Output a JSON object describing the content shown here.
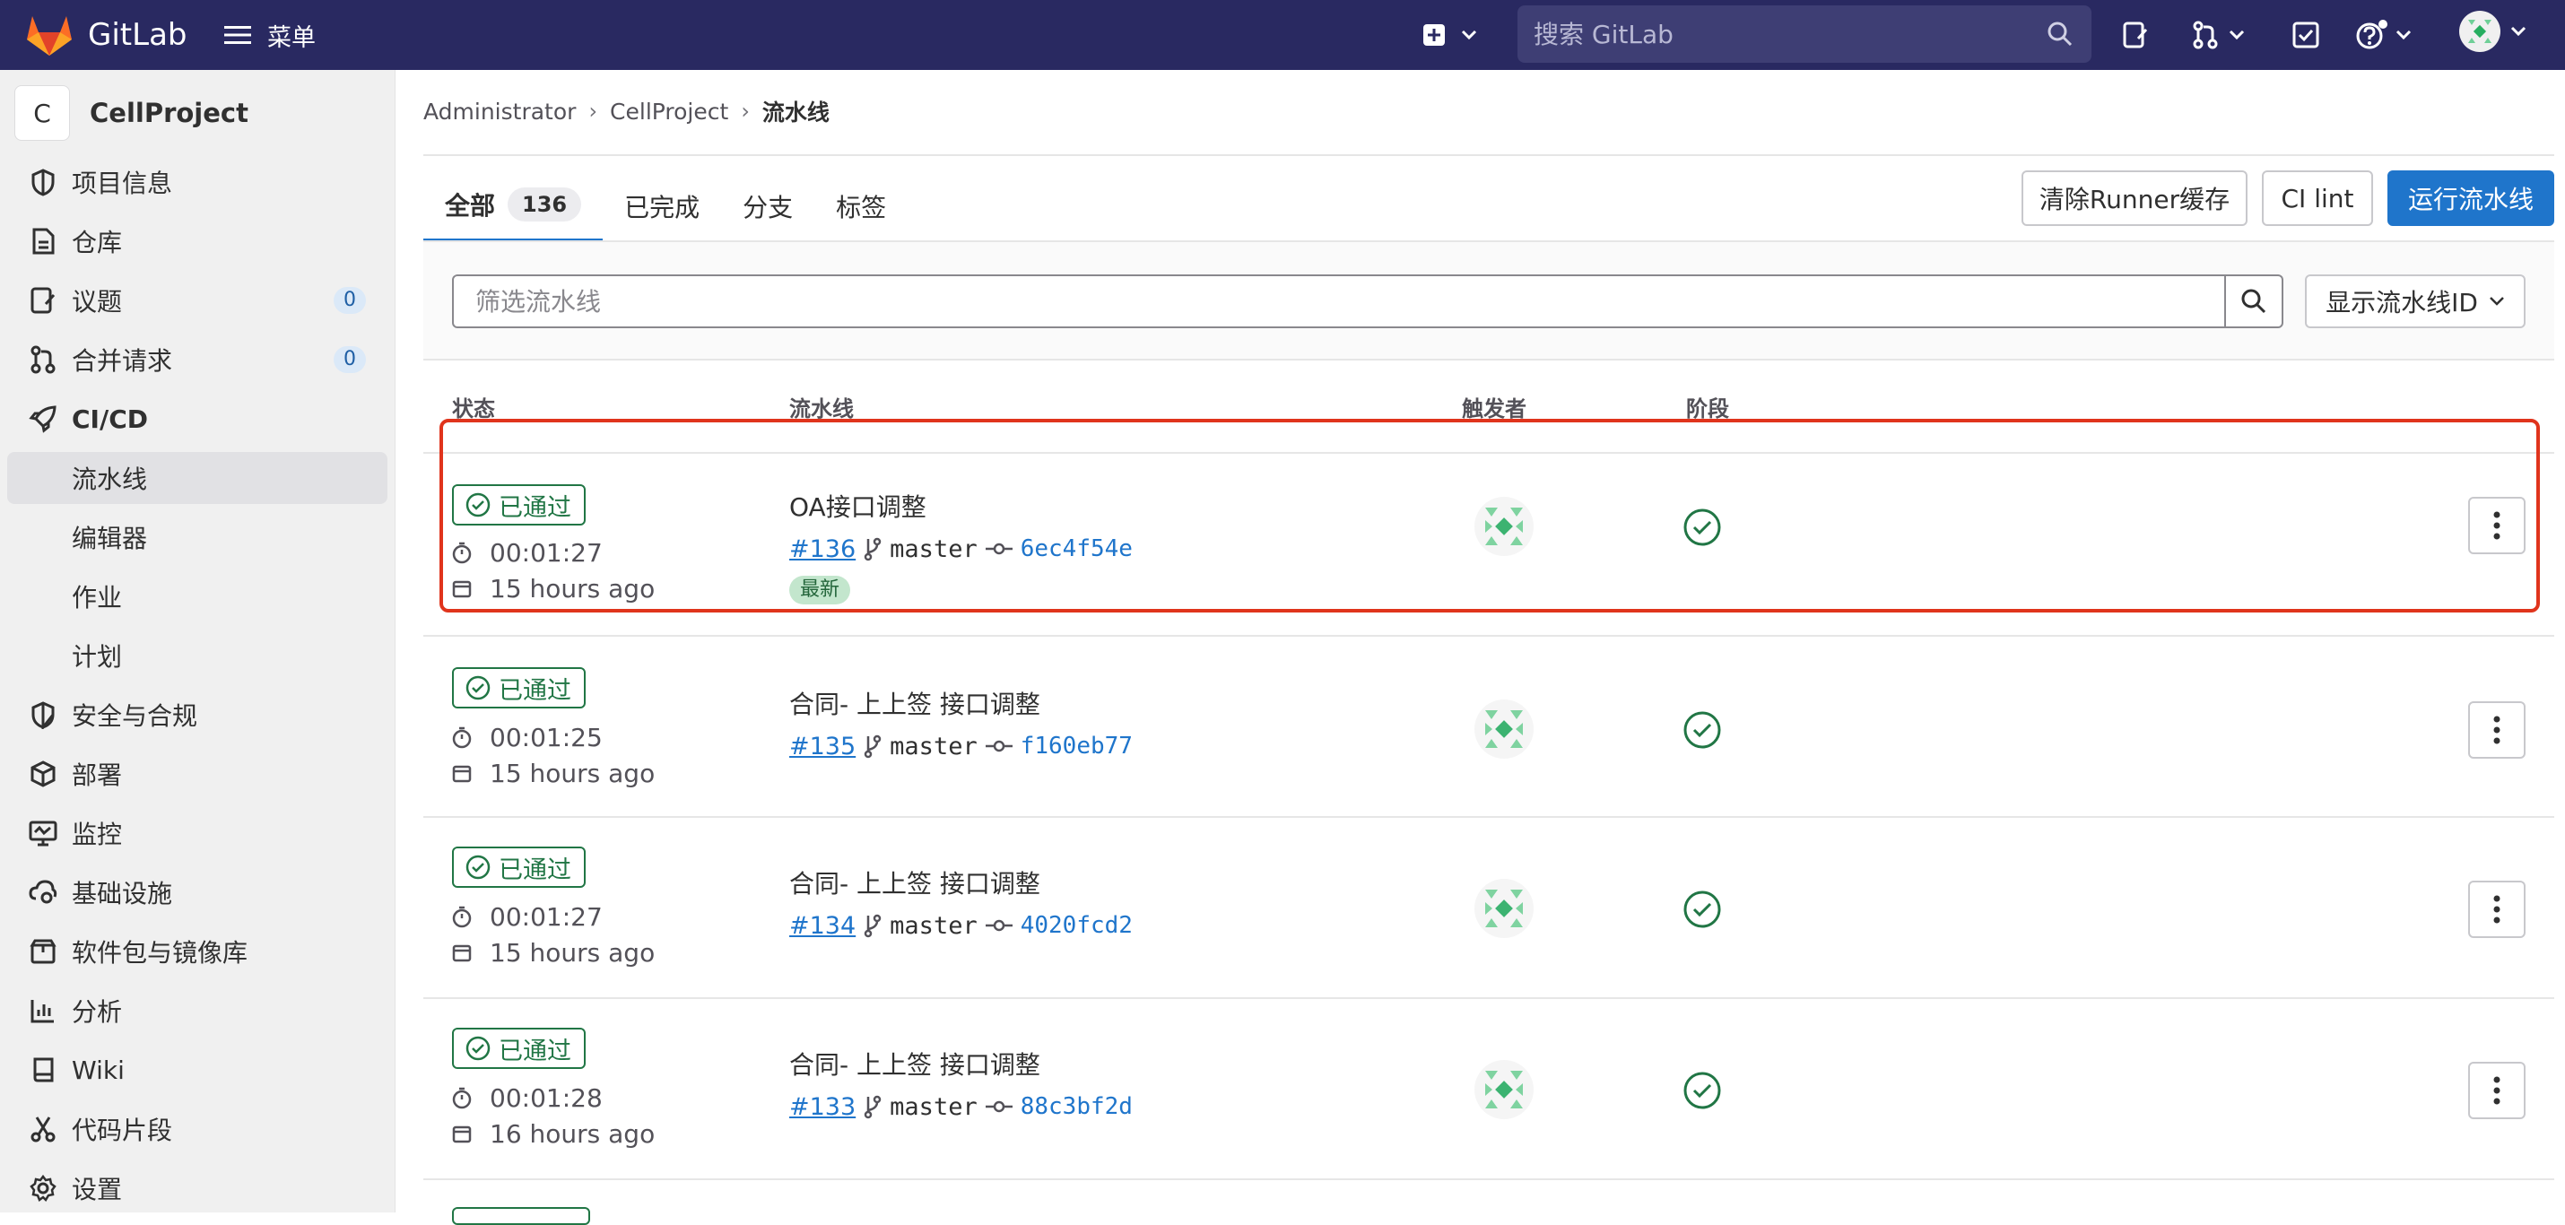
{
  "topbar": {
    "brand": "GitLab",
    "menu_label": "菜单",
    "search_placeholder": "搜索 GitLab",
    "icons": [
      "plus-square-icon",
      "chevron-down-icon",
      "search-icon",
      "issues-icon",
      "merge-request-icon",
      "todo-icon",
      "help-icon",
      "avatar"
    ]
  },
  "sidebar": {
    "project_initial": "C",
    "project_name": "CellProject",
    "items": [
      {
        "label": "项目信息",
        "icon": "info-icon"
      },
      {
        "label": "仓库",
        "icon": "doc-icon"
      },
      {
        "label": "议题",
        "icon": "issues-icon",
        "count": "0"
      },
      {
        "label": "合并请求",
        "icon": "merge-request-icon",
        "count": "0"
      },
      {
        "label": "CI/CD",
        "icon": "rocket-icon"
      },
      {
        "label": "流水线"
      },
      {
        "label": "编辑器"
      },
      {
        "label": "作业"
      },
      {
        "label": "计划"
      },
      {
        "label": "安全与合规",
        "icon": "shield-icon"
      },
      {
        "label": "部署",
        "icon": "deploy-icon"
      },
      {
        "label": "监控",
        "icon": "monitor-icon"
      },
      {
        "label": "基础设施",
        "icon": "cloud-gear-icon"
      },
      {
        "label": "软件包与镜像库",
        "icon": "package-icon"
      },
      {
        "label": "分析",
        "icon": "chart-icon"
      },
      {
        "label": "Wiki",
        "icon": "book-icon"
      },
      {
        "label": "代码片段",
        "icon": "scissors-icon"
      },
      {
        "label": "设置",
        "icon": "settings-icon"
      }
    ]
  },
  "breadcrumb": [
    "Administrator",
    "CellProject",
    "流水线"
  ],
  "tabs": [
    {
      "label": "全部",
      "count": "136"
    },
    {
      "label": "已完成"
    },
    {
      "label": "分支"
    },
    {
      "label": "标签"
    }
  ],
  "actions": {
    "clear_cache": "清除Runner缓存",
    "ci_lint": "CI lint",
    "run_pipeline": "运行流水线"
  },
  "filter": {
    "placeholder": "筛选流水线",
    "show_id": "显示流水线ID"
  },
  "columns": {
    "status": "状态",
    "pipeline": "流水线",
    "triggerer": "触发者",
    "stages": "阶段"
  },
  "pipelines": [
    {
      "status": "已通过",
      "duration": "00:01:27",
      "finished": "15 hours ago",
      "title": "OA接口调整",
      "id": "#136",
      "branch": "master",
      "sha": "6ec4f54e",
      "badge": "最新"
    },
    {
      "status": "已通过",
      "duration": "00:01:25",
      "finished": "15 hours ago",
      "title": "合同- 上上签 接口调整",
      "id": "#135",
      "branch": "master",
      "sha": "f160eb77"
    },
    {
      "status": "已通过",
      "duration": "00:01:27",
      "finished": "15 hours ago",
      "title": "合同- 上上签 接口调整",
      "id": "#134",
      "branch": "master",
      "sha": "4020fcd2"
    },
    {
      "status": "已通过",
      "duration": "00:01:28",
      "finished": "16 hours ago",
      "title": "合同- 上上签 接口调整",
      "id": "#133",
      "branch": "master",
      "sha": "88c3bf2d"
    }
  ],
  "colors": {
    "topbar": "#292961",
    "primary": "#1f75cb",
    "success": "#217645",
    "highlight": "#e0341c"
  }
}
